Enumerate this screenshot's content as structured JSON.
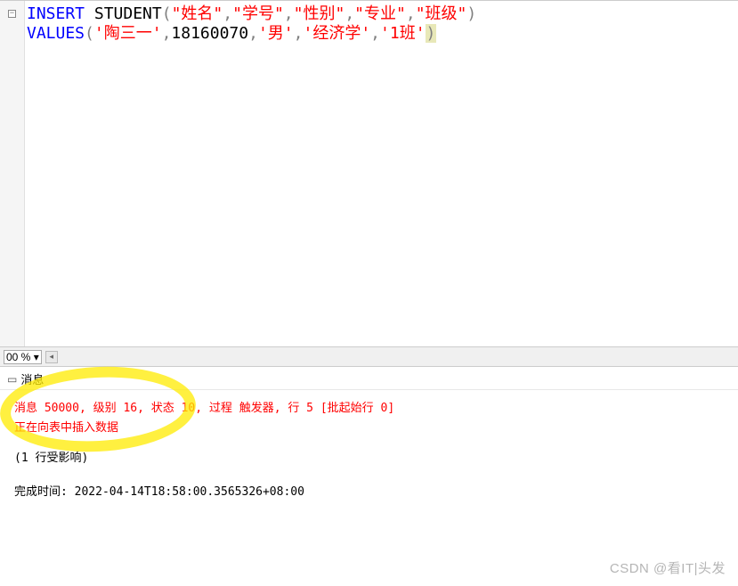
{
  "editor": {
    "fold_glyph": "−",
    "code": {
      "line1": {
        "kw1": "INSERT",
        "t1": " STUDENT",
        "p1": "(",
        "s1": "\"姓名\"",
        "c1": ",",
        "s2": "\"学号\"",
        "c2": ",",
        "s3": "\"性别\"",
        "c3": ",",
        "s4": "\"专业\"",
        "c4": ",",
        "s5": "\"班级\"",
        "p2": ")"
      },
      "line2": {
        "kw1": "VALUES",
        "p1": "(",
        "s1": "'陶三一'",
        "c1": ",",
        "n1": "18160070",
        "c2": ",",
        "s2": "'男'",
        "c3": ",",
        "s3": "'经济学'",
        "c4": ",",
        "s4": "'1班'",
        "p2": ")"
      }
    }
  },
  "zoom": {
    "value": "00 %",
    "arrow": "▾",
    "scroll_glyph": "◂"
  },
  "messages": {
    "tab_label": "消息",
    "error_line": "消息 50000, 级别 16, 状态 10, 过程 触发器, 行 5 [批起始行 0]",
    "info_line": "正在向表中插入数据",
    "affected_line": "(1 行受影响)",
    "completion_line": "完成时间: 2022-04-14T18:58:00.3565326+08:00"
  },
  "watermark": "CSDN @看IT|头发"
}
